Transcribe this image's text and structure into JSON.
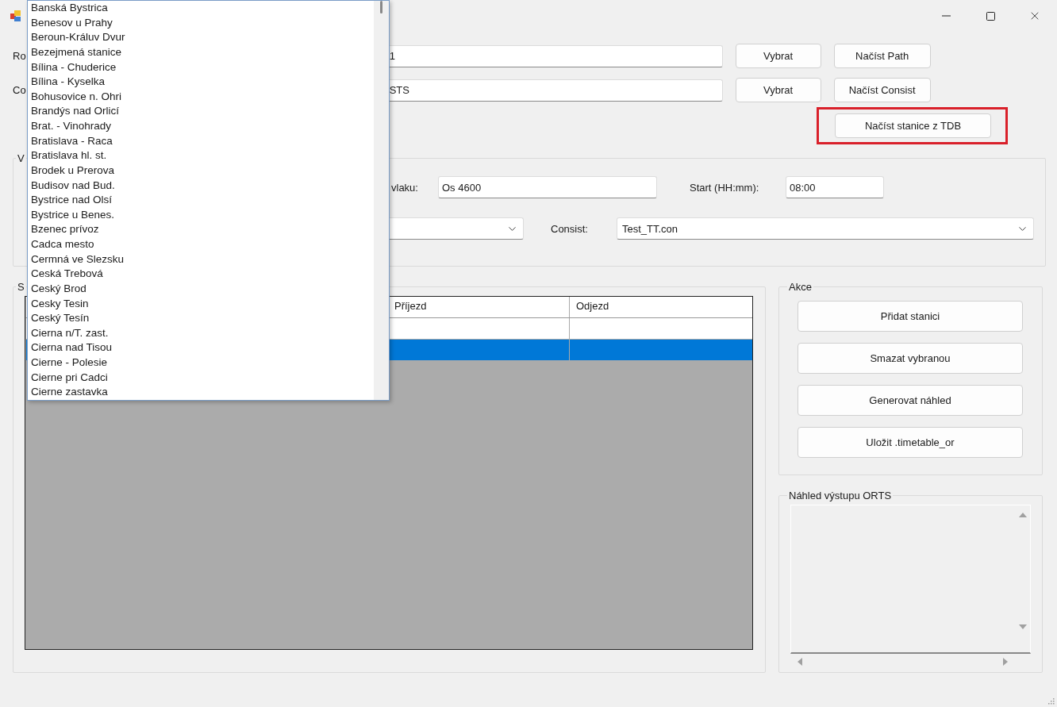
{
  "path_row": {
    "label": "Ro",
    "value": "1",
    "buttons": [
      "Vybrat",
      "Načíst Path"
    ]
  },
  "consist_row": {
    "label": "Co",
    "value": "STS",
    "buttons": [
      "Vybrat",
      "Načíst Consist"
    ]
  },
  "load_stations_button": {
    "label": "Načíst stanice z TDB",
    "highlighted": true
  },
  "train_group": {
    "title": "V",
    "number_label": "vlaku:",
    "number_value": "Os 4600",
    "start_label": "Start (HH:mm):",
    "start_value": "08:00",
    "consist_label": "Consist:",
    "consist_value": "Test_TT.con"
  },
  "stations_group": {
    "title": "S",
    "columns": [
      "Příjezd",
      "Odjezd"
    ],
    "rows": [
      {
        "selected": false
      },
      {
        "selected": true
      }
    ]
  },
  "actions_group": {
    "title": "Akce",
    "buttons": [
      "Přidat stanici",
      "Smazat vybranou",
      "Generovat náhled",
      "Uložit .timetable_or"
    ]
  },
  "preview_group": {
    "title": "Náhled výstupu ORTS"
  },
  "station_dropdown": {
    "items": [
      "Banská Bystrica",
      "Benesov u Prahy",
      "Beroun-Králuv Dvur",
      "Bezejmená stanice",
      "Bílina - Chuderice",
      "Bílina - Kyselka",
      "Bohusovice n. Ohri",
      "Brandýs nad Orlicí",
      "Brat. - Vinohrady",
      "Bratislava - Raca",
      "Bratislava hl. st.",
      "Brodek u Prerova",
      "Budisov nad Bud.",
      "Bystrice nad Olsí",
      "Bystrice u Benes.",
      "Bzenec prívoz",
      "Cadca mesto",
      "Cermná ve Slezsku",
      "Ceská Trebová",
      "Ceský Brod",
      "Cesky Tesin",
      "Ceský Tesín",
      "Cierna n/T. zast.",
      "Cierna nad Tisou",
      "Cierne - Polesie",
      "Cierne pri Cadci",
      "Cierne zastavka"
    ]
  }
}
